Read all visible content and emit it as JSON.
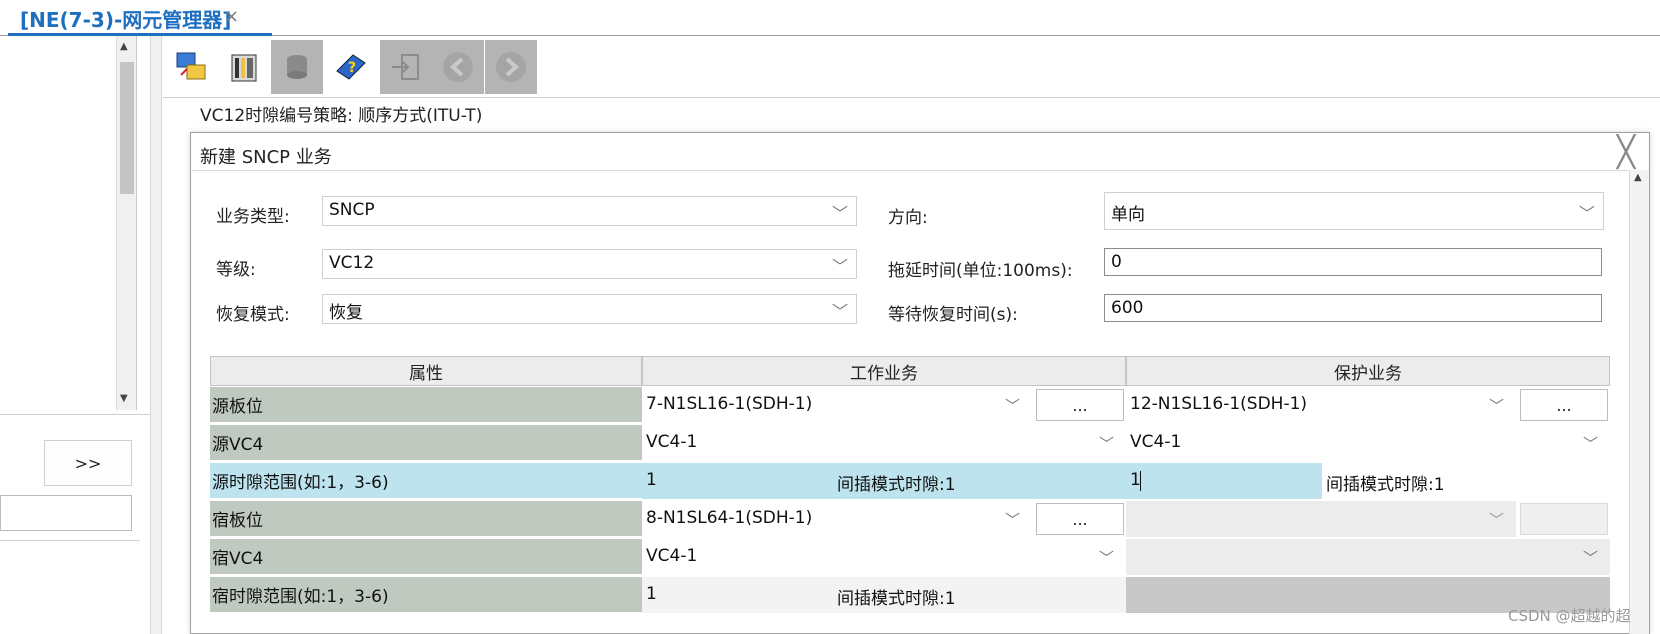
{
  "tab": {
    "title": "[NE(7-3)-网元管理器]",
    "close": "×"
  },
  "left": {
    "more_label": ">>"
  },
  "toolbar": {
    "buttons": [
      {
        "icon": "network-config-icon",
        "enabled": true
      },
      {
        "icon": "board-view-icon",
        "enabled": true
      },
      {
        "icon": "database-icon",
        "enabled": false
      },
      {
        "icon": "help-book-icon",
        "enabled": true
      },
      {
        "icon": "login-icon",
        "enabled": false
      },
      {
        "icon": "back-arrow-icon",
        "enabled": false
      },
      {
        "icon": "forward-arrow-icon",
        "enabled": false
      }
    ]
  },
  "background": {
    "vc12_info": "VC12时隙编号策略: 顺序方式(ITU-T)"
  },
  "dialog": {
    "title": "新建 SNCP 业务",
    "close": "╳",
    "form": {
      "service_type_label": "业务类型:",
      "service_type_value": "SNCP",
      "direction_label": "方向:",
      "direction_value": "单向",
      "level_label": "等级:",
      "level_value": "VC12",
      "hold_off_label": "拖延时间(单位:100ms):",
      "hold_off_value": "0",
      "revert_mode_label": "恢复模式:",
      "revert_mode_value": "恢复",
      "wtr_label": "等待恢复时间(s):",
      "wtr_value": "600"
    },
    "grid": {
      "headers": [
        "属性",
        "工作业务",
        "保护业务"
      ],
      "rows": {
        "src_board": {
          "label": "源板位",
          "work": "7-N1SL16-1(SDH-1)",
          "protect": "12-N1SL16-1(SDH-1)",
          "ellipsis": "..."
        },
        "src_vc4": {
          "label": "源VC4",
          "work": "VC4-1",
          "protect": "VC4-1"
        },
        "src_ts": {
          "label": "源时隙范围(如:1，3-6)",
          "work": "1",
          "work_note": "间插模式时隙:1",
          "protect": "1",
          "protect_note": "间插模式时隙:1"
        },
        "sink_board": {
          "label": "宿板位",
          "work": "8-N1SL64-1(SDH-1)",
          "ellipsis": "..."
        },
        "sink_vc4": {
          "label": "宿VC4",
          "work": "VC4-1"
        },
        "sink_ts": {
          "label": "宿时隙范围(如:1，3-6)",
          "work": "1",
          "work_note": "间插模式时隙:1"
        }
      }
    }
  },
  "watermark": "CSDN @超越的超"
}
